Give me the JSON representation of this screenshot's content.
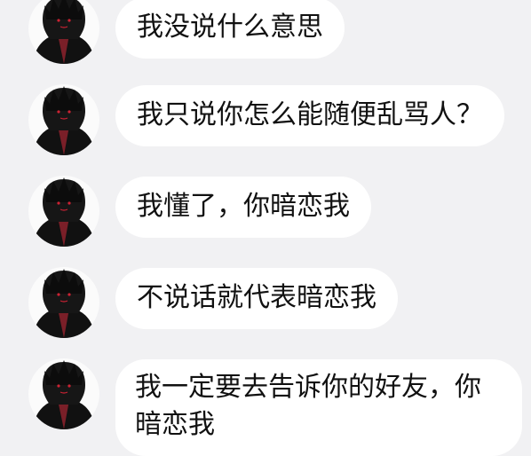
{
  "conversation": {
    "messages": [
      {
        "text": "我没说什么意思"
      },
      {
        "text": "我只说你怎么能随便乱骂人？"
      },
      {
        "text": "我懂了，你暗恋我"
      },
      {
        "text": "不说话就代表暗恋我"
      },
      {
        "text": "我一定要去告诉你的好友，你暗恋我"
      }
    ]
  },
  "colors": {
    "background": "#f1f1f3",
    "bubble": "#ffffff",
    "text": "#111111"
  }
}
